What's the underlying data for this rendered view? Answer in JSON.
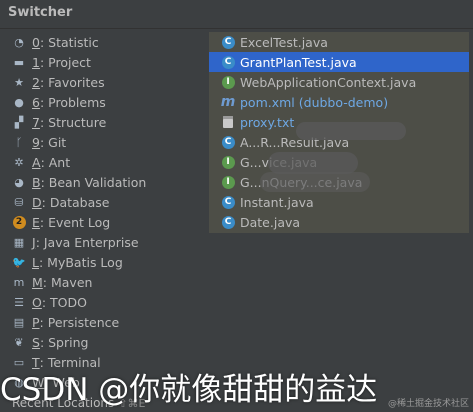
{
  "window": {
    "title": "Switcher"
  },
  "tool_windows": [
    {
      "icon": "statistic-icon",
      "mnemonic": "0",
      "label": ": Statistic"
    },
    {
      "icon": "project-icon",
      "mnemonic": "1",
      "label": ": Project"
    },
    {
      "icon": "favorites-icon",
      "mnemonic": "2",
      "label": ": Favorites"
    },
    {
      "icon": "problems-icon",
      "mnemonic": "6",
      "label": ": Problems"
    },
    {
      "icon": "structure-icon",
      "mnemonic": "7",
      "label": ": Structure"
    },
    {
      "icon": "git-icon",
      "mnemonic": "9",
      "label": ": Git"
    },
    {
      "icon": "ant-icon",
      "mnemonic": "A",
      "label": ": Ant"
    },
    {
      "icon": "bean-validation-icon",
      "mnemonic": "B",
      "label": ": Bean Validation"
    },
    {
      "icon": "database-icon",
      "mnemonic": "D",
      "label": ": Database"
    },
    {
      "icon": "event-log-icon",
      "mnemonic": "E",
      "label": ": Event Log",
      "badge": "2"
    },
    {
      "icon": "java-enterprise-icon",
      "mnemonic": "J",
      "label": ": Java Enterprise"
    },
    {
      "icon": "mybatis-log-icon",
      "mnemonic": "L",
      "label": ": MyBatis Log"
    },
    {
      "icon": "maven-icon",
      "mnemonic": "M",
      "label": ": Maven"
    },
    {
      "icon": "todo-icon",
      "mnemonic": "O",
      "label": ": TODO"
    },
    {
      "icon": "persistence-icon",
      "mnemonic": "P",
      "label": ": Persistence"
    },
    {
      "icon": "spring-icon",
      "mnemonic": "S",
      "label": ": Spring"
    },
    {
      "icon": "terminal-icon",
      "mnemonic": "T",
      "label": ": Terminal"
    },
    {
      "icon": "web-icon",
      "mnemonic": "W",
      "label": ": Web"
    }
  ],
  "files": [
    {
      "icon": "class",
      "name": "ExcelTest.java",
      "selected": false
    },
    {
      "icon": "class",
      "name": "GrantPlanTest.java",
      "selected": true
    },
    {
      "icon": "interface",
      "name": "WebApplicationContext.java",
      "selected": false
    },
    {
      "icon": "maven",
      "name": "pom.xml (dubbo-demo)",
      "selected": false,
      "blue": true
    },
    {
      "icon": "text",
      "name": "proxy.txt",
      "selected": false,
      "blue": true
    },
    {
      "icon": "class",
      "name": "A...R...Result.java",
      "selected": false
    },
    {
      "icon": "interface",
      "name": "G...vice.java",
      "selected": false
    },
    {
      "icon": "interface",
      "name": "G...nQuery...ce.java",
      "selected": false
    },
    {
      "icon": "class",
      "name": "Instant.java",
      "selected": false
    },
    {
      "icon": "class",
      "name": "Date.java",
      "selected": false
    }
  ],
  "footer": {
    "label": "Recent Locations",
    "shortcut": "⇧⌘E"
  },
  "watermark": {
    "text": "CSDN @你就像甜甜的益达",
    "small": "@稀土掘金技术社区"
  }
}
